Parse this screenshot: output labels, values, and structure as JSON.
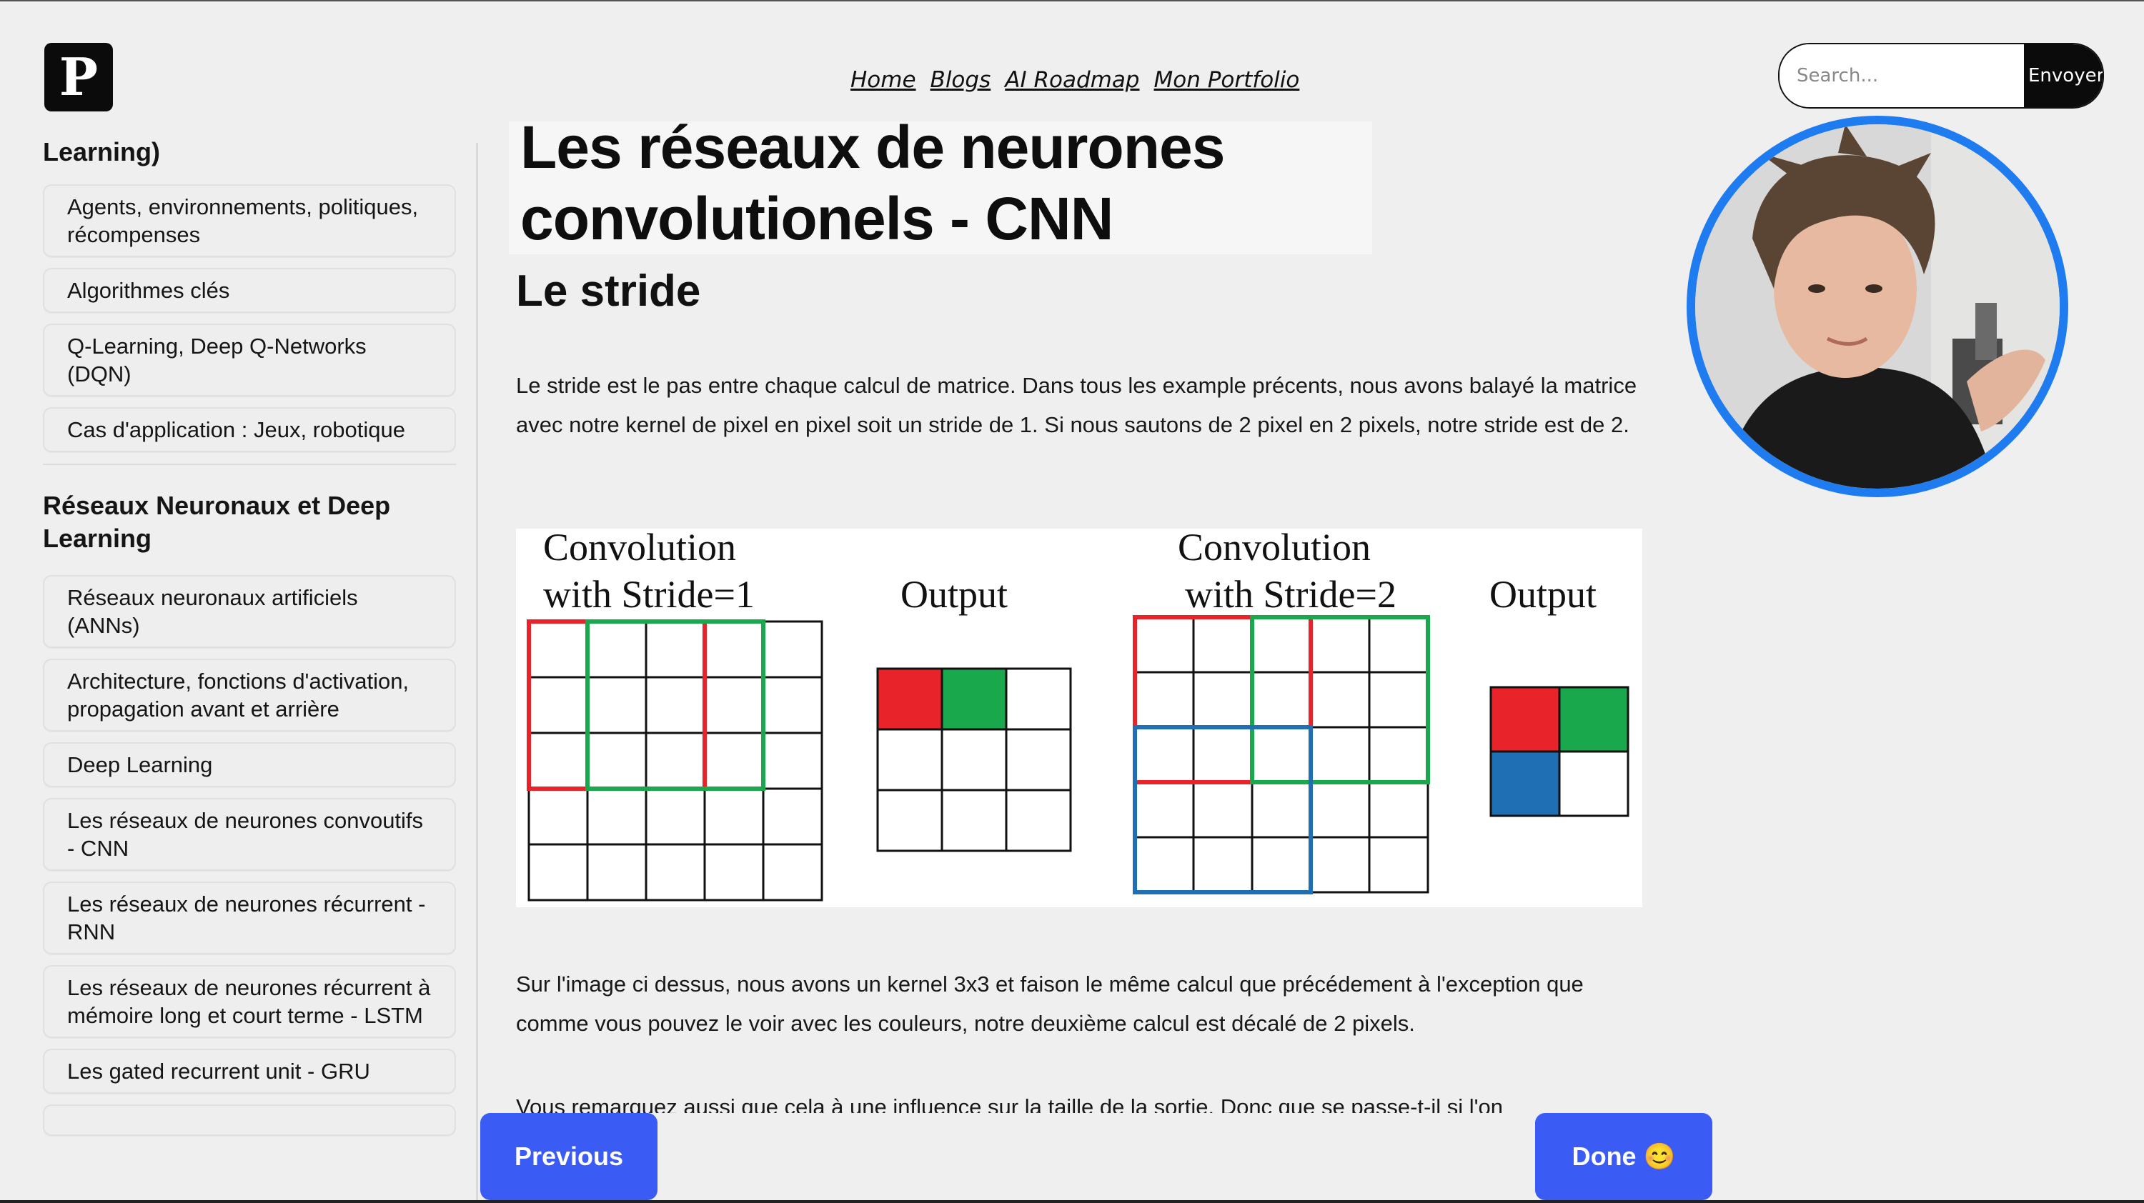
{
  "header": {
    "logo_letter": "P",
    "nav": [
      "Home",
      "Blogs",
      "AI Roadmap",
      "Mon Portfolio"
    ],
    "search": {
      "placeholder": "Search...",
      "button": "Envoyer"
    }
  },
  "sidebar": {
    "section1_title_tail": "Learning)",
    "section1_items": [
      "Agents, environnements, politiques, récompenses",
      "Algorithmes clés",
      "Q-Learning, Deep Q-Networks (DQN)",
      "Cas d'application : Jeux, robotique"
    ],
    "section2_title": "Réseaux Neuronaux et Deep Learning",
    "section2_items": [
      "Réseaux neuronaux artificiels (ANNs)",
      "Architecture, fonctions d'activation, propagation avant et arrière",
      "Deep Learning",
      "Les réseaux de neurones convoutifs - CNN",
      "Les réseaux de neurones récurrent - RNN",
      "Les réseaux de neurones récurrent à mémoire long et court terme - LSTM",
      "Les gated recurrent unit - GRU"
    ]
  },
  "main": {
    "title": "Les réseaux de neurones convolutionels - CNN",
    "subtitle": "Le stride",
    "paragraph1": "Le stride est le pas entre chaque calcul de matrice. Dans tous les example précents, nous avons balayé la matrice avec notre kernel de pixel en pixel soit un stride de 1. Si nous sautons de 2 pixel en 2 pixels, notre stride est de 2.",
    "figure": {
      "label1_line1": "Convolution",
      "label1_line2": "with Stride=1",
      "label2": "Output",
      "label3_line1": "Convolution",
      "label3_line2": "with Stride=2",
      "label4": "Output",
      "colors": {
        "red": "#e8232a",
        "green": "#19a84c",
        "blue": "#1e6fb4"
      }
    },
    "paragraph2": "Sur l'image ci dessus, nous avons un kernel 3x3 et faison le même calcul que précédement à l'exception que comme vous pouvez le voir avec les couleurs, notre deuxième calcul est décalé de 2 pixels.",
    "paragraph3": "Vous remarquez aussi que cela à une influence sur la taille de la sortie. Donc que se passe-t-il si l'on"
  },
  "footer": {
    "previous": "Previous",
    "done": "Done 😊"
  },
  "colors": {
    "accent": "#3b5bf5",
    "avatar_ring": "#1e7cf0"
  }
}
